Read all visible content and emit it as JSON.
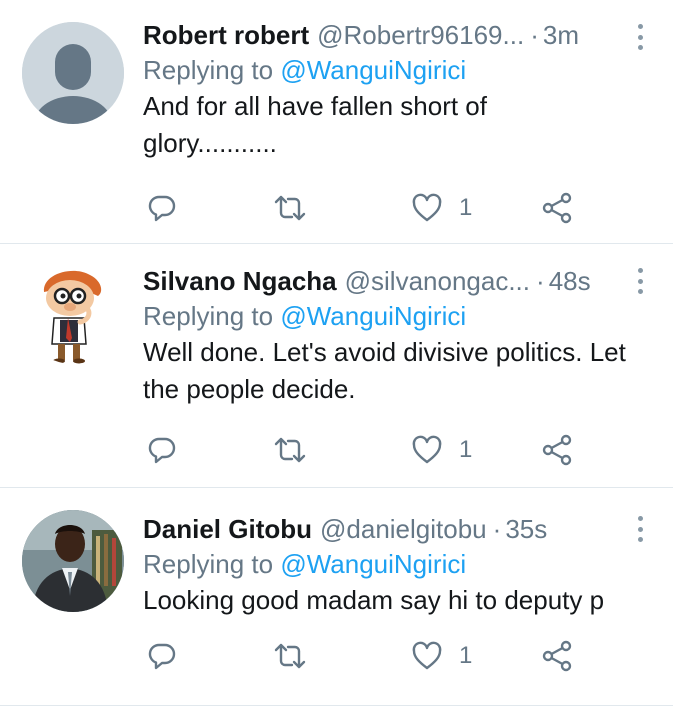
{
  "tweets": [
    {
      "name": "Robert robert",
      "handle": "@Robertr96169...",
      "separator": "·",
      "time": "3m",
      "replying_prefix": "Replying to ",
      "replying_user": "@WanguiNgirici",
      "text": "And for all have fallen short of glory...........",
      "like_count": "1",
      "avatar": "default-avatar-icon"
    },
    {
      "name": "Silvano Ngacha",
      "handle": "@silvanongac...",
      "separator": "·",
      "time": "48s",
      "replying_prefix": "Replying to ",
      "replying_user": "@WanguiNgirici",
      "text": "Well done. Let's avoid divisive politics. Let the people decide.",
      "like_count": "1",
      "avatar": "cartoon-avatar"
    },
    {
      "name": "Daniel Gitobu",
      "handle": "@danielgitobu",
      "separator": "·",
      "time": "35s",
      "replying_prefix": "Replying to ",
      "replying_user": "@WanguiNgirici",
      "text": "Looking good madam say hi to deputy p",
      "like_count": "1",
      "avatar": "photo-avatar"
    }
  ],
  "icons": {
    "reply": "reply-icon",
    "retweet": "retweet-icon",
    "like": "heart-icon",
    "share": "share-icon",
    "more": "more-options-icon"
  },
  "colors": {
    "link": "#1da1f2",
    "secondary_text": "#657786",
    "icon": "#657786",
    "divider": "#e1e8ed"
  }
}
